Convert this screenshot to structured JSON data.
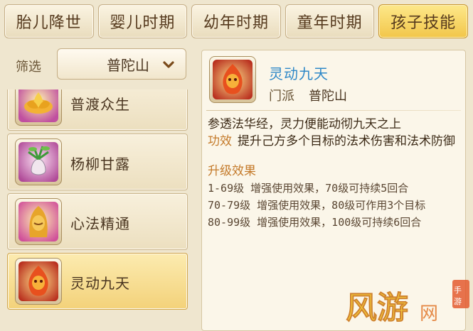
{
  "tabs": [
    {
      "label": "胎儿降世",
      "active": false
    },
    {
      "label": "婴儿时期",
      "active": false
    },
    {
      "label": "幼年时期",
      "active": false
    },
    {
      "label": "童年时期",
      "active": false
    },
    {
      "label": "孩子技能",
      "active": true
    }
  ],
  "filter": {
    "label": "筛选",
    "selected": "普陀山",
    "icon": "chevron-down-icon"
  },
  "skills": [
    {
      "name": "普渡众生",
      "icon": "lotus-icon",
      "selected": false
    },
    {
      "name": "杨柳甘露",
      "icon": "willow-vase-icon",
      "selected": false
    },
    {
      "name": "心法精通",
      "icon": "buddha-icon",
      "selected": false
    },
    {
      "name": "灵动九天",
      "icon": "flame-spirit-icon",
      "selected": true
    }
  ],
  "detail": {
    "title": "灵动九天",
    "school_label": "门派",
    "school": "普陀山",
    "description": "参透法华经，灵力便能动彻九天之上",
    "effect_label": "功效",
    "effect": "提升己方多个目标的法术伤害和法术防御",
    "upgrade_title": "升级效果",
    "upgrades": [
      "1-69级  增强使用效果，70级可持续5回合",
      "70-79级  增强使用效果，80级可作用3个目标",
      "80-99级  增强使用效果，100级可持续6回合"
    ]
  },
  "watermark": {
    "text": "手游 风游网"
  },
  "colors": {
    "active_tab": "#f2c64a",
    "title_blue": "#2e88c8",
    "label_orange": "#c47a2a",
    "background": "#efe6cf"
  }
}
